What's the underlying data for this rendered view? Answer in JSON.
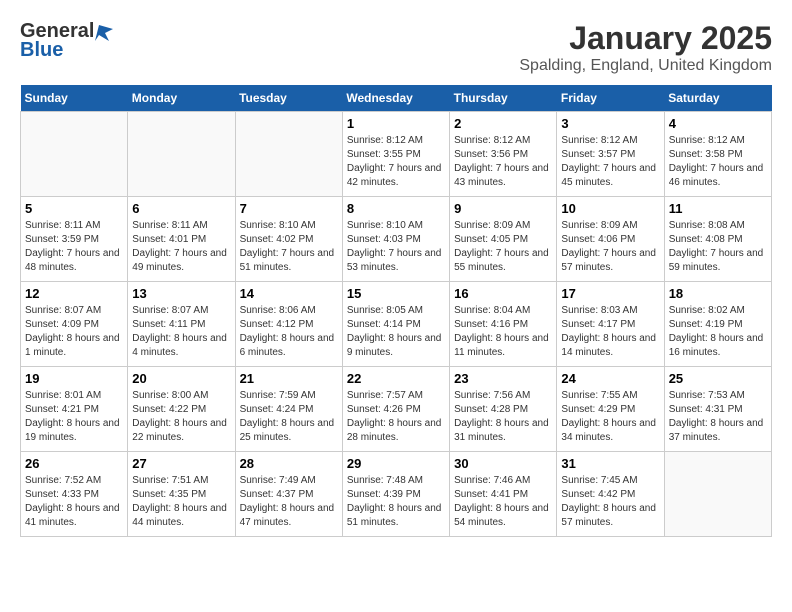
{
  "logo": {
    "general": "General",
    "blue": "Blue"
  },
  "title": "January 2025",
  "subtitle": "Spalding, England, United Kingdom",
  "headers": [
    "Sunday",
    "Monday",
    "Tuesday",
    "Wednesday",
    "Thursday",
    "Friday",
    "Saturday"
  ],
  "weeks": [
    [
      {
        "day": "",
        "info": ""
      },
      {
        "day": "",
        "info": ""
      },
      {
        "day": "",
        "info": ""
      },
      {
        "day": "1",
        "info": "Sunrise: 8:12 AM\nSunset: 3:55 PM\nDaylight: 7 hours and 42 minutes."
      },
      {
        "day": "2",
        "info": "Sunrise: 8:12 AM\nSunset: 3:56 PM\nDaylight: 7 hours and 43 minutes."
      },
      {
        "day": "3",
        "info": "Sunrise: 8:12 AM\nSunset: 3:57 PM\nDaylight: 7 hours and 45 minutes."
      },
      {
        "day": "4",
        "info": "Sunrise: 8:12 AM\nSunset: 3:58 PM\nDaylight: 7 hours and 46 minutes."
      }
    ],
    [
      {
        "day": "5",
        "info": "Sunrise: 8:11 AM\nSunset: 3:59 PM\nDaylight: 7 hours and 48 minutes."
      },
      {
        "day": "6",
        "info": "Sunrise: 8:11 AM\nSunset: 4:01 PM\nDaylight: 7 hours and 49 minutes."
      },
      {
        "day": "7",
        "info": "Sunrise: 8:10 AM\nSunset: 4:02 PM\nDaylight: 7 hours and 51 minutes."
      },
      {
        "day": "8",
        "info": "Sunrise: 8:10 AM\nSunset: 4:03 PM\nDaylight: 7 hours and 53 minutes."
      },
      {
        "day": "9",
        "info": "Sunrise: 8:09 AM\nSunset: 4:05 PM\nDaylight: 7 hours and 55 minutes."
      },
      {
        "day": "10",
        "info": "Sunrise: 8:09 AM\nSunset: 4:06 PM\nDaylight: 7 hours and 57 minutes."
      },
      {
        "day": "11",
        "info": "Sunrise: 8:08 AM\nSunset: 4:08 PM\nDaylight: 7 hours and 59 minutes."
      }
    ],
    [
      {
        "day": "12",
        "info": "Sunrise: 8:07 AM\nSunset: 4:09 PM\nDaylight: 8 hours and 1 minute."
      },
      {
        "day": "13",
        "info": "Sunrise: 8:07 AM\nSunset: 4:11 PM\nDaylight: 8 hours and 4 minutes."
      },
      {
        "day": "14",
        "info": "Sunrise: 8:06 AM\nSunset: 4:12 PM\nDaylight: 8 hours and 6 minutes."
      },
      {
        "day": "15",
        "info": "Sunrise: 8:05 AM\nSunset: 4:14 PM\nDaylight: 8 hours and 9 minutes."
      },
      {
        "day": "16",
        "info": "Sunrise: 8:04 AM\nSunset: 4:16 PM\nDaylight: 8 hours and 11 minutes."
      },
      {
        "day": "17",
        "info": "Sunrise: 8:03 AM\nSunset: 4:17 PM\nDaylight: 8 hours and 14 minutes."
      },
      {
        "day": "18",
        "info": "Sunrise: 8:02 AM\nSunset: 4:19 PM\nDaylight: 8 hours and 16 minutes."
      }
    ],
    [
      {
        "day": "19",
        "info": "Sunrise: 8:01 AM\nSunset: 4:21 PM\nDaylight: 8 hours and 19 minutes."
      },
      {
        "day": "20",
        "info": "Sunrise: 8:00 AM\nSunset: 4:22 PM\nDaylight: 8 hours and 22 minutes."
      },
      {
        "day": "21",
        "info": "Sunrise: 7:59 AM\nSunset: 4:24 PM\nDaylight: 8 hours and 25 minutes."
      },
      {
        "day": "22",
        "info": "Sunrise: 7:57 AM\nSunset: 4:26 PM\nDaylight: 8 hours and 28 minutes."
      },
      {
        "day": "23",
        "info": "Sunrise: 7:56 AM\nSunset: 4:28 PM\nDaylight: 8 hours and 31 minutes."
      },
      {
        "day": "24",
        "info": "Sunrise: 7:55 AM\nSunset: 4:29 PM\nDaylight: 8 hours and 34 minutes."
      },
      {
        "day": "25",
        "info": "Sunrise: 7:53 AM\nSunset: 4:31 PM\nDaylight: 8 hours and 37 minutes."
      }
    ],
    [
      {
        "day": "26",
        "info": "Sunrise: 7:52 AM\nSunset: 4:33 PM\nDaylight: 8 hours and 41 minutes."
      },
      {
        "day": "27",
        "info": "Sunrise: 7:51 AM\nSunset: 4:35 PM\nDaylight: 8 hours and 44 minutes."
      },
      {
        "day": "28",
        "info": "Sunrise: 7:49 AM\nSunset: 4:37 PM\nDaylight: 8 hours and 47 minutes."
      },
      {
        "day": "29",
        "info": "Sunrise: 7:48 AM\nSunset: 4:39 PM\nDaylight: 8 hours and 51 minutes."
      },
      {
        "day": "30",
        "info": "Sunrise: 7:46 AM\nSunset: 4:41 PM\nDaylight: 8 hours and 54 minutes."
      },
      {
        "day": "31",
        "info": "Sunrise: 7:45 AM\nSunset: 4:42 PM\nDaylight: 8 hours and 57 minutes."
      },
      {
        "day": "",
        "info": ""
      }
    ]
  ]
}
